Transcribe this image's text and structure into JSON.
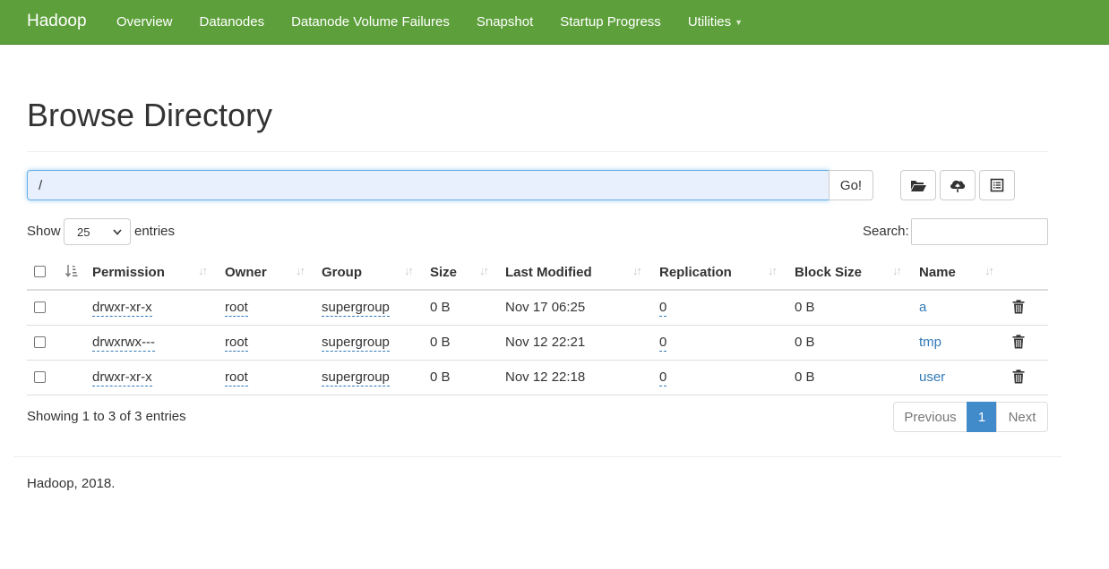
{
  "navbar": {
    "brand": "Hadoop",
    "items": [
      {
        "label": "Overview"
      },
      {
        "label": "Datanodes"
      },
      {
        "label": "Datanode Volume Failures"
      },
      {
        "label": "Snapshot"
      },
      {
        "label": "Startup Progress"
      },
      {
        "label": "Utilities",
        "has_dropdown": true
      }
    ],
    "color": "#5da03b"
  },
  "page": {
    "title": "Browse Directory"
  },
  "path_bar": {
    "value": "/",
    "go_label": "Go!",
    "tools": [
      "folder-open-icon",
      "cloud-upload-icon",
      "list-alt-icon"
    ]
  },
  "table_controls": {
    "show_label": "Show",
    "page_length": "25",
    "entries_label": "entries",
    "search_label": "Search:"
  },
  "table": {
    "columns": [
      "Permission",
      "Owner",
      "Group",
      "Size",
      "Last Modified",
      "Replication",
      "Block Size",
      "Name"
    ],
    "rows": [
      {
        "permission": "drwxr-xr-x",
        "owner": "root",
        "group": "supergroup",
        "size": "0 B",
        "modified": "Nov 17 06:25",
        "replication": "0",
        "block_size": "0 B",
        "name": "a"
      },
      {
        "permission": "drwxrwx---",
        "owner": "root",
        "group": "supergroup",
        "size": "0 B",
        "modified": "Nov 12 22:21",
        "replication": "0",
        "block_size": "0 B",
        "name": "tmp"
      },
      {
        "permission": "drwxr-xr-x",
        "owner": "root",
        "group": "supergroup",
        "size": "0 B",
        "modified": "Nov 12 22:18",
        "replication": "0",
        "block_size": "0 B",
        "name": "user"
      }
    ]
  },
  "pagination": {
    "info": "Showing 1 to 3 of 3 entries",
    "previous": "Previous",
    "current": "1",
    "next": "Next",
    "active_color": "#428bca"
  },
  "footer": {
    "text": "Hadoop, 2018."
  }
}
